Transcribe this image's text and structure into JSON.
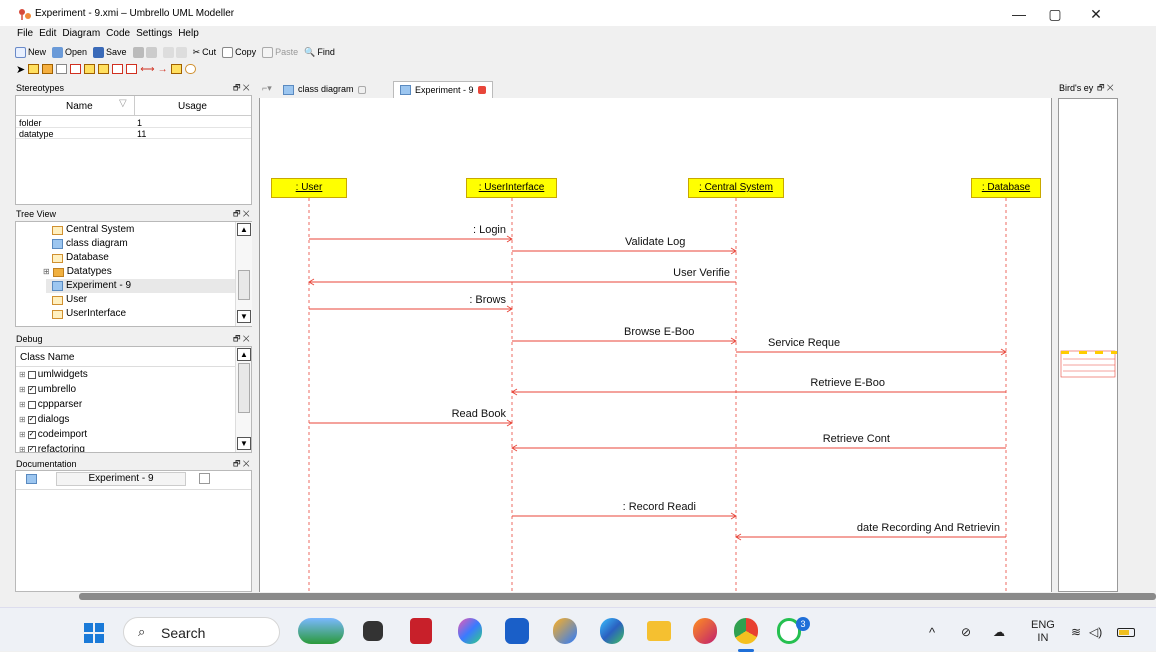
{
  "window": {
    "title": "Experiment - 9.xmi – Umbrello UML Modeller",
    "minimize": "—",
    "maximize": "▢",
    "close": "✕"
  },
  "menu": [
    "File",
    "Edit",
    "Diagram",
    "Code",
    "Settings",
    "Help"
  ],
  "toolbar": {
    "new": "New",
    "open": "Open",
    "save": "Save",
    "cut": "Cut",
    "copy": "Copy",
    "paste": "Paste",
    "find": "Find"
  },
  "stereotypes": {
    "title": "Stereotypes",
    "col_name": "Name",
    "col_usage": "Usage",
    "rows": [
      {
        "name": "folder",
        "usage": "1"
      },
      {
        "name": "datatype",
        "usage": "11"
      }
    ]
  },
  "treeview": {
    "title": "Tree View",
    "items": [
      {
        "label": "Central System",
        "icon": "class-icon"
      },
      {
        "label": "class diagram",
        "icon": "diagram-icon"
      },
      {
        "label": "Database",
        "icon": "class-icon"
      },
      {
        "label": "Datatypes",
        "icon": "folder-icon"
      },
      {
        "label": "Experiment - 9",
        "icon": "diagram-icon"
      },
      {
        "label": "User",
        "icon": "class-icon"
      },
      {
        "label": "UserInterface",
        "icon": "class-icon"
      }
    ]
  },
  "debug": {
    "title": "Debug",
    "header": "Class Name",
    "items": [
      {
        "label": "umlwidgets",
        "checked": false
      },
      {
        "label": "umbrello",
        "checked": true
      },
      {
        "label": "cppparser",
        "checked": false
      },
      {
        "label": "dialogs",
        "checked": true
      },
      {
        "label": "codeimport",
        "checked": true
      },
      {
        "label": "refactoring",
        "checked": true
      }
    ]
  },
  "documentation": {
    "title": "Documentation",
    "name": "Experiment - 9"
  },
  "dock_controls": "🗗 ✕",
  "tabs": [
    {
      "label": "class diagram",
      "active": false
    },
    {
      "label": "Experiment - 9",
      "active": true
    }
  ],
  "birds_eye": {
    "title": "Bird's ey"
  },
  "lifelines": [
    {
      "label": ": User"
    },
    {
      "label": ": UserInterface"
    },
    {
      "label": ": Central System"
    },
    {
      "label": ": Database"
    }
  ],
  "messages": [
    {
      "label": ": Login"
    },
    {
      "label": "Validate Log"
    },
    {
      "label": "User Verifie"
    },
    {
      "label": ": Brows"
    },
    {
      "label": "Browse E-Boo"
    },
    {
      "label": "Service Reque"
    },
    {
      "label": "Retrieve E-Boo"
    },
    {
      "label": "Read Book"
    },
    {
      "label": "Retrieve Cont"
    },
    {
      "label": ": Record Readi"
    },
    {
      "label": "date Recording And Retrievin"
    }
  ],
  "taskbar": {
    "search": "Search",
    "lang_top": "ENG",
    "lang_bottom": "IN",
    "badge": "3",
    "tray_arrow": "^"
  },
  "colors": {
    "lifeline_fill": "#ffff00",
    "message_line": "#e8463a",
    "lifeline_dash": "#e8463a"
  }
}
